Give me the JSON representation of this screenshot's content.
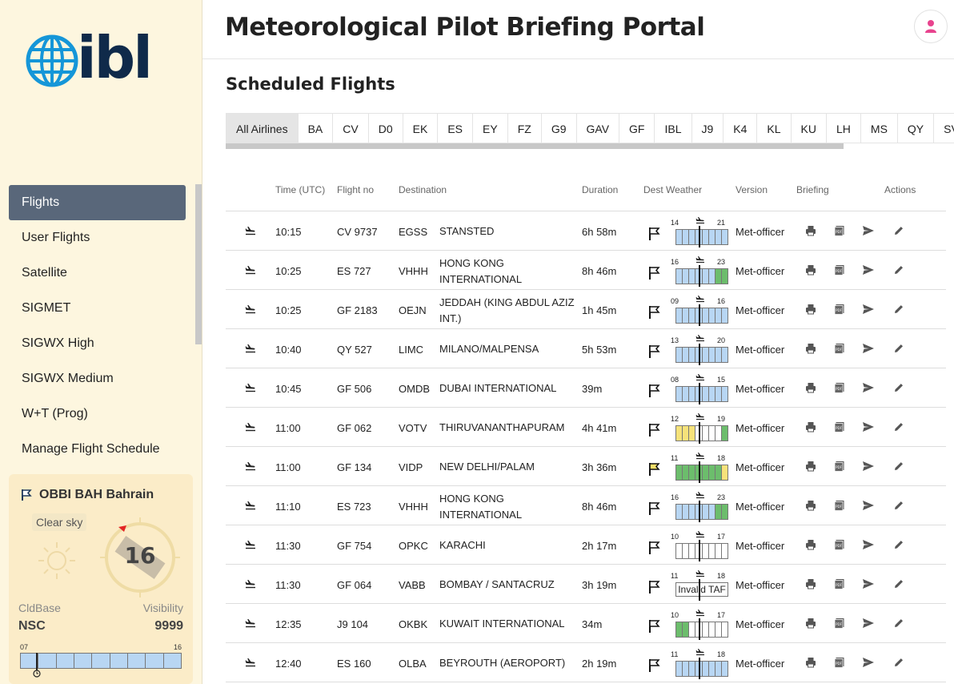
{
  "app": {
    "title": "Meteorological Pilot Briefing Portal",
    "logo_text": "ibl"
  },
  "colors": {
    "accent": "#59677a",
    "sidebar_bg": "#fdf6df",
    "wx_blue": "#b8d6f3",
    "wx_green": "#6cbd6c",
    "wx_yellow": "#f6e27a",
    "avatar_pink": "#e8438e"
  },
  "sidebar": {
    "items": [
      {
        "label": "Flights",
        "active": true
      },
      {
        "label": "User Flights"
      },
      {
        "label": "Satellite"
      },
      {
        "label": "SIGMET"
      },
      {
        "label": "SIGWX High"
      },
      {
        "label": "SIGWX Medium"
      },
      {
        "label": "W+T (Prog)"
      },
      {
        "label": "Manage Flight Schedule"
      }
    ]
  },
  "weather_card": {
    "station": "OBBI BAH Bahrain",
    "condition": "Clear sky",
    "wind_speed": "16",
    "cldbase_label": "CldBase",
    "cldbase_value": "NSC",
    "visibility_label": "Visibility",
    "visibility_value": "9999",
    "timeline_start": "07",
    "timeline_end": "16"
  },
  "main": {
    "section_title": "Scheduled Flights",
    "tabs": [
      "All Airlines",
      "BA",
      "CV",
      "D0",
      "EK",
      "ES",
      "EY",
      "FZ",
      "G9",
      "GAV",
      "GF",
      "IBL",
      "J9",
      "K4",
      "KL",
      "KU",
      "LH",
      "MS",
      "QY",
      "SV"
    ],
    "columns": {
      "time": "Time (UTC)",
      "flight_no": "Flight no",
      "destination": "Destination",
      "duration": "Duration",
      "dest_weather": "Dest Weather",
      "version": "Version",
      "briefing": "Briefing",
      "actions": "Actions"
    },
    "flights": [
      {
        "time": "10:15",
        "flight_no": "CV 9737",
        "dest_code": "EGSS",
        "dest_name": "STANSTED",
        "duration": "6h 58m",
        "wx_start": "14",
        "wx_end": "21",
        "wx_cells": [
          "b",
          "b",
          "b",
          "b",
          "b",
          "b",
          "b",
          "b"
        ],
        "flag": "white",
        "version": "Met-officer"
      },
      {
        "time": "10:25",
        "flight_no": "ES 727",
        "dest_code": "VHHH",
        "dest_name": "HONG KONG INTERNATIONAL",
        "duration": "8h 46m",
        "wx_start": "16",
        "wx_end": "23",
        "wx_cells": [
          "b",
          "b",
          "b",
          "b",
          "b",
          "b",
          "g",
          "g"
        ],
        "flag": "white",
        "version": "Met-officer"
      },
      {
        "time": "10:25",
        "flight_no": "GF 2183",
        "dest_code": "OEJN",
        "dest_name": "JEDDAH (KING ABDUL AZIZ INT.)",
        "duration": "1h 45m",
        "wx_start": "09",
        "wx_end": "16",
        "wx_cells": [
          "b",
          "b",
          "b",
          "b",
          "b",
          "b",
          "b",
          "b"
        ],
        "flag": "white",
        "version": "Met-officer"
      },
      {
        "time": "10:40",
        "flight_no": "QY 527",
        "dest_code": "LIMC",
        "dest_name": "MILANO/MALPENSA",
        "duration": "5h 53m",
        "wx_start": "13",
        "wx_end": "20",
        "wx_cells": [
          "b",
          "b",
          "b",
          "b",
          "b",
          "b",
          "b",
          "b"
        ],
        "flag": "white",
        "version": "Met-officer"
      },
      {
        "time": "10:45",
        "flight_no": "GF 506",
        "dest_code": "OMDB",
        "dest_name": "DUBAI INTERNATIONAL",
        "duration": "39m",
        "wx_start": "08",
        "wx_end": "15",
        "wx_cells": [
          "b",
          "b",
          "b",
          "b",
          "b",
          "b",
          "b",
          "b"
        ],
        "flag": "white",
        "version": "Met-officer"
      },
      {
        "time": "11:00",
        "flight_no": "GF 062",
        "dest_code": "VOTV",
        "dest_name": "THIRUVANANTHAPURAM",
        "duration": "4h 41m",
        "wx_start": "12",
        "wx_end": "19",
        "wx_cells": [
          "y",
          "y",
          "y",
          "w",
          "w",
          "w",
          "w",
          "g"
        ],
        "flag": "white",
        "version": "Met-officer"
      },
      {
        "time": "11:00",
        "flight_no": "GF 134",
        "dest_code": "VIDP",
        "dest_name": "NEW DELHI/PALAM",
        "duration": "3h 36m",
        "wx_start": "11",
        "wx_end": "18",
        "wx_cells": [
          "g",
          "g",
          "g",
          "g",
          "g",
          "g",
          "g",
          "y"
        ],
        "flag": "yellow",
        "version": "Met-officer"
      },
      {
        "time": "11:10",
        "flight_no": "ES 723",
        "dest_code": "VHHH",
        "dest_name": "HONG KONG INTERNATIONAL",
        "duration": "8h 46m",
        "wx_start": "16",
        "wx_end": "23",
        "wx_cells": [
          "b",
          "b",
          "b",
          "b",
          "b",
          "b",
          "g",
          "g"
        ],
        "flag": "white",
        "version": "Met-officer"
      },
      {
        "time": "11:30",
        "flight_no": "GF 754",
        "dest_code": "OPKC",
        "dest_name": "KARACHI",
        "duration": "2h 17m",
        "wx_start": "10",
        "wx_end": "17",
        "wx_cells": [
          "w",
          "w",
          "w",
          "w",
          "w",
          "w",
          "w",
          "w"
        ],
        "flag": "white",
        "version": "Met-officer"
      },
      {
        "time": "11:30",
        "flight_no": "GF 064",
        "dest_code": "VABB",
        "dest_name": "BOMBAY / SANTACRUZ",
        "duration": "3h 19m",
        "wx_start": "11",
        "wx_end": "18",
        "wx_cells": [],
        "invalid": "Invalid TAF",
        "flag": "white",
        "version": "Met-officer"
      },
      {
        "time": "12:35",
        "flight_no": "J9 104",
        "dest_code": "OKBK",
        "dest_name": "KUWAIT INTERNATIONAL",
        "duration": "34m",
        "wx_start": "10",
        "wx_end": "17",
        "wx_cells": [
          "g",
          "g",
          "w",
          "w",
          "w",
          "w",
          "w",
          "w"
        ],
        "flag": "white",
        "version": "Met-officer"
      },
      {
        "time": "12:40",
        "flight_no": "ES 160",
        "dest_code": "OLBA",
        "dest_name": "BEYROUTH (AEROPORT)",
        "duration": "2h 19m",
        "wx_start": "11",
        "wx_end": "18",
        "wx_cells": [
          "b",
          "b",
          "b",
          "b",
          "b",
          "b",
          "b",
          "b"
        ],
        "flag": "white",
        "version": "Met-officer"
      }
    ]
  }
}
